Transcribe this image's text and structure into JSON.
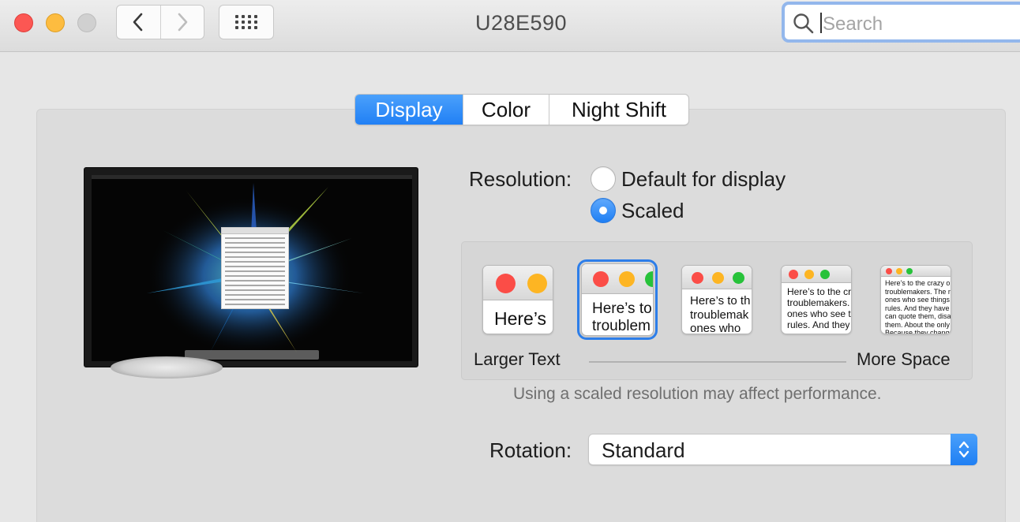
{
  "window": {
    "title": "U28E590",
    "search_placeholder": "Search"
  },
  "icons": {
    "back": "chevron-left-icon",
    "forward": "chevron-right-icon",
    "grid": "show-all-grid-icon",
    "search": "magnifier-icon",
    "stepper": "up-down-chevron-icon"
  },
  "tabs": [
    {
      "label": "Display",
      "active": true
    },
    {
      "label": "Color",
      "active": false
    },
    {
      "label": "Night Shift",
      "active": false
    }
  ],
  "resolution": {
    "label": "Resolution:",
    "options": [
      {
        "label": "Default for display",
        "selected": false
      },
      {
        "label": "Scaled",
        "selected": true
      }
    ],
    "scaled_options": [
      {
        "text": "Here’s",
        "selected": false
      },
      {
        "text": "Here’s to\ntroublem",
        "selected": true
      },
      {
        "text": "Here’s to th\ntroublemak\nones who",
        "selected": false
      },
      {
        "text": "Here’s to the cr\ntroublemakers.\nones who see t\nrules. And they",
        "selected": false
      },
      {
        "text": "Here’s to the crazy one\ntroublemakers. The rou\nones who see things di\nrules. And they have no\ncan quote them, disagre\nthem. About the only th\nBecause they change t",
        "selected": false
      }
    ],
    "larger_label": "Larger Text",
    "more_label": "More Space",
    "note": "Using a scaled resolution may affect performance."
  },
  "rotation": {
    "label": "Rotation:",
    "value": "Standard"
  },
  "colors": {
    "accent": "#2180f5",
    "close": "#fc5753",
    "minimize": "#fdbc40",
    "zoom_disabled": "#d0d0d0"
  }
}
